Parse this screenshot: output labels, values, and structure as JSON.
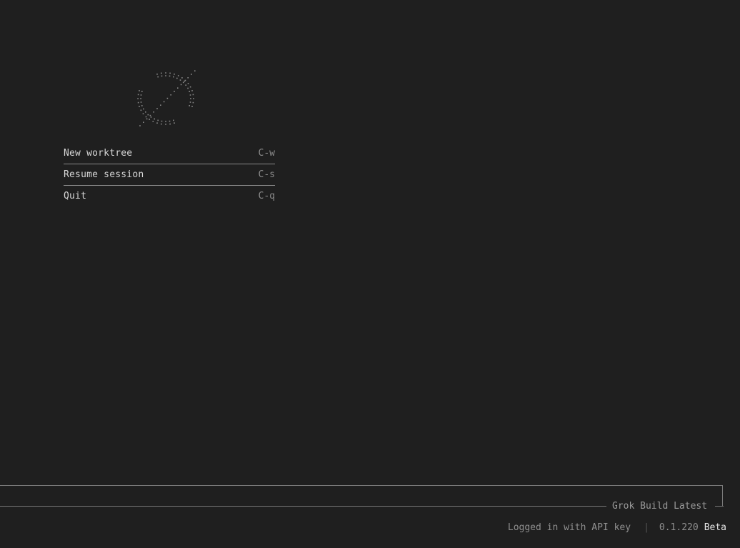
{
  "menu": {
    "items": [
      {
        "label": "New worktree",
        "shortcut": "C-w"
      },
      {
        "label": "Resume session",
        "shortcut": "C-s"
      },
      {
        "label": "Quit",
        "shortcut": "C-q"
      }
    ]
  },
  "input": {
    "model_label": "Grok Build Latest"
  },
  "status": {
    "auth": "Logged in with API key",
    "separator": "|",
    "version": "0.1.220",
    "channel": "Beta"
  },
  "colors": {
    "background": "#1f1f1f",
    "text": "#d4d4d4",
    "muted": "#8c8c8c",
    "border": "#7a7a7a"
  },
  "icons": {
    "logo": "grok-dotted-logo"
  }
}
